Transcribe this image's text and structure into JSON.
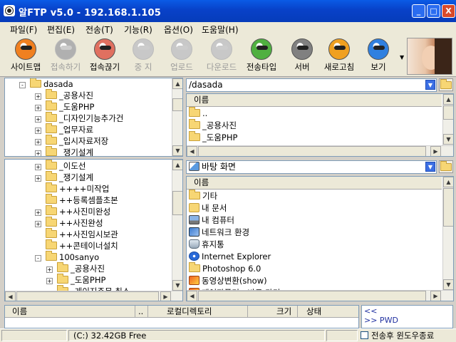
{
  "window": {
    "title": "알FTP v5.0 - 192.168.1.105",
    "min": "_",
    "max": "□",
    "close": "X"
  },
  "menu": [
    "파일(F)",
    "편집(E)",
    "전송(T)",
    "기능(R)",
    "옵션(O)",
    "도움말(H)"
  ],
  "toolbar": {
    "items": [
      {
        "label": "사이트맵",
        "icon": "sitemap-icon",
        "color": "#f08020",
        "enabled": true
      },
      {
        "label": "접속하기",
        "icon": "connect-icon",
        "color": "#b0b0b0",
        "enabled": false
      },
      {
        "label": "접속끊기",
        "icon": "disconnect-icon",
        "color": "#e07060",
        "enabled": true
      },
      {
        "label": "중 지",
        "icon": "stop-icon",
        "color": "#c8c8c8",
        "enabled": false
      },
      {
        "label": "업로드",
        "icon": "upload-icon",
        "color": "#c8c8c8",
        "enabled": false
      },
      {
        "label": "다운로드",
        "icon": "download-icon",
        "color": "#c8c8c8",
        "enabled": false
      },
      {
        "label": "전송타입",
        "icon": "transfer-type-icon",
        "color": "#50b040",
        "enabled": true
      },
      {
        "label": "서버",
        "icon": "server-icon",
        "color": "#808080",
        "enabled": true
      },
      {
        "label": "새로고침",
        "icon": "refresh-icon",
        "color": "#f0a020",
        "enabled": true
      },
      {
        "label": "보기",
        "icon": "view-icon",
        "color": "#3080e0",
        "enabled": true
      }
    ]
  },
  "remote_tree": {
    "root": "dasada",
    "items": [
      "_공용사진",
      "_도움PHP",
      "_디자인기능추가건",
      "_업무자료",
      "_입시자료저장",
      "_쟁기설계"
    ]
  },
  "local_tree": {
    "items": [
      {
        "label": "_이도선",
        "exp": "+",
        "indent": 1
      },
      {
        "label": "_쟁기설계",
        "exp": "+",
        "indent": 1
      },
      {
        "label": "++++미작업",
        "exp": "",
        "indent": 1
      },
      {
        "label": "++등록셈플초본",
        "exp": "",
        "indent": 1
      },
      {
        "label": "++사진미완성",
        "exp": "+",
        "indent": 1
      },
      {
        "label": "++사진완성",
        "exp": "+",
        "indent": 1
      },
      {
        "label": "++사진임시보관",
        "exp": "",
        "indent": 1
      },
      {
        "label": "++콘테이너설치",
        "exp": "",
        "indent": 1
      },
      {
        "label": "100sanyo",
        "exp": "-",
        "indent": 1
      },
      {
        "label": "_공용사진",
        "exp": "+",
        "indent": 2
      },
      {
        "label": "_도움PHP",
        "exp": "+",
        "indent": 2
      },
      {
        "label": "_게이지주문 취소",
        "exp": "",
        "indent": 2
      }
    ]
  },
  "remote_list": {
    "path": "/dasada",
    "header": "이름",
    "items": [
      "..",
      "_공용사진",
      "_도움PHP"
    ]
  },
  "local_list": {
    "path": "바탕 화면",
    "header": "이름",
    "items": [
      {
        "label": "기타",
        "kind": "folder"
      },
      {
        "label": "내 문서",
        "kind": "mydocs"
      },
      {
        "label": "내 컴퓨터",
        "kind": "computer"
      },
      {
        "label": "네트워크 환경",
        "kind": "network"
      },
      {
        "label": "휴지통",
        "kind": "trash"
      },
      {
        "label": "Internet Explorer",
        "kind": "ie"
      },
      {
        "label": "Photoshop 6.0",
        "kind": "folder"
      },
      {
        "label": "동영상변환(show)",
        "kind": "app"
      },
      {
        "label": "제어판폴더 - 바로 가기",
        "kind": "app"
      }
    ]
  },
  "queue": {
    "columns": [
      "이름",
      "..",
      "로컬디렉토리",
      "크기",
      "상태"
    ]
  },
  "log": {
    "lines": [
      "<<",
      ">> PWD"
    ]
  },
  "status": {
    "drive": "(C:)  32.42GB Free",
    "checkbox": "전송후 윈도우종료"
  }
}
